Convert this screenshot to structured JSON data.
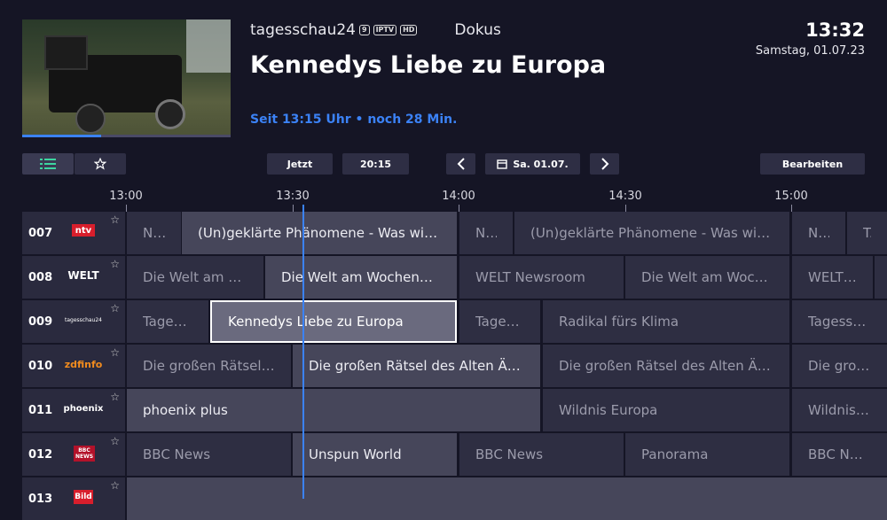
{
  "header": {
    "channel": "tagesschau24",
    "badges": [
      "9",
      "IPTV",
      "HD"
    ],
    "genre": "Dokus",
    "title": "Kennedys Liebe zu Europa",
    "since": "Seit 13:15 Uhr • noch 28 Min.",
    "clock": "13:32",
    "date": "Samstag, 01.07.23",
    "progress_fraction": 0.38
  },
  "toolbar": {
    "list_icon": "list-icon",
    "star_icon": "star-icon",
    "now_label": "Jetzt",
    "time_label": "20:15",
    "prev_icon": "chevron-left-icon",
    "date_label": "Sa. 01.07.",
    "next_icon": "chevron-right-icon",
    "edit_label": "Bearbeiten"
  },
  "timeline": [
    "13:00",
    "13:30",
    "14:00",
    "14:30",
    "15:00"
  ],
  "colors": {
    "accent": "#3b82f6",
    "background": "#151525"
  },
  "rows": [
    {
      "num": "007",
      "logo": "ntv",
      "programs": [
        {
          "label": "N..."
        },
        {
          "label": "(Un)geklärte Phänomene - Was wirkli..."
        },
        {
          "label": "N..."
        },
        {
          "label": "(Un)geklärte Phänomene - Was wirkli..."
        },
        {
          "label": "N..."
        },
        {
          "label": "Tuta"
        }
      ]
    },
    {
      "num": "008",
      "logo": "WELT",
      "programs": [
        {
          "label": "Die Welt am Mi..."
        },
        {
          "label": "Die Welt am Wochenende"
        },
        {
          "label": "WELT Newsroom"
        },
        {
          "label": "Die Welt am Woche..."
        },
        {
          "label": "WELT ..."
        },
        {
          "label": ""
        }
      ]
    },
    {
      "num": "009",
      "logo": "tagesschau24",
      "programs": [
        {
          "label": "Tages..."
        },
        {
          "label": "Kennedys Liebe zu Europa"
        },
        {
          "label": "Tages..."
        },
        {
          "label": "Radikal fürs Klima"
        },
        {
          "label": "Tagesschau-Ü"
        }
      ]
    },
    {
      "num": "010",
      "logo": "zdfinfo",
      "programs": [
        {
          "label": "Die großen Rätsel d..."
        },
        {
          "label": "Die großen Rätsel des Alten Ägyp..."
        },
        {
          "label": "Die großen Rätsel des Alten Ägyp..."
        },
        {
          "label": "Die großen R"
        }
      ]
    },
    {
      "num": "011",
      "logo": "phoenix",
      "programs": [
        {
          "label": "phoenix plus"
        },
        {
          "label": "Wildnis Europa"
        },
        {
          "label": "Wildnis Euro"
        }
      ]
    },
    {
      "num": "012",
      "logo": "BBC NEWS",
      "programs": [
        {
          "label": "BBC News"
        },
        {
          "label": "Unspun World"
        },
        {
          "label": "BBC News"
        },
        {
          "label": "Panorama"
        },
        {
          "label": "BBC News"
        }
      ]
    },
    {
      "num": "013",
      "logo": "Bild",
      "programs": [
        {
          "label": ""
        }
      ]
    }
  ]
}
